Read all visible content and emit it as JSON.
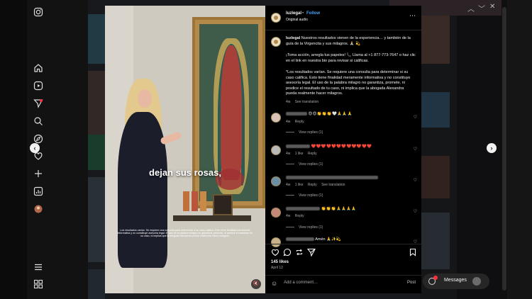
{
  "post": {
    "username": "luzlegal",
    "follow_label": "Follow",
    "audio": "Original audio",
    "caption_p1": "Nuestros resultados vienen de la experiencia… y también de la guía de la Virgencita y sus milagros. 🙏🏼 💫",
    "caption_p2": "¡Toma acción, arregla tus papeles! 📞 Llama al +1 877-773-7647 o haz clic en el link en nuestra bio para revisar si calificas.",
    "caption_p3": "*Los resultados varían. Se requiere una consulta para determinar si su caso califica. Esto tiene finalidad meramente informativa y no constituye asesoría legal. El uso de la palabra milagro no garantiza, promete, ni predice el resultado de tu caso, ni implica que la abogada Alexandra pueda realmente hacer milagros.",
    "caption_time": "4w",
    "see_translation": "See translation",
    "video_caption": "dejan sus rosas,",
    "video_disclaimer": "Los resultados varían. Se requiere una consulta para determinar si su caso califica. Esto tiene finalidad meramente informativa y no constituye asesoría legal. El uso de la palabra milagro no garantiza, promete, ni predice el resultado de su caso, ni implica que la abogada Alexandra pueda realmente hacer milagros."
  },
  "comments": [
    {
      "text": "😍😍👏👏👏🤍🙏🙏🙏",
      "time": "4w",
      "likes": "",
      "reply": "Reply",
      "translate": "",
      "view_replies": "View replies (1)"
    },
    {
      "text": "❤️❤️❤️❤️❤️❤️❤️❤️❤️❤️❤️❤️",
      "time": "4w",
      "likes": "1 like",
      "reply": "Reply",
      "translate": "",
      "view_replies": "View replies (1)"
    },
    {
      "text": "",
      "time": "4w",
      "likes": "1 like",
      "reply": "Reply",
      "translate": "See translation",
      "view_replies": "View replies (1)"
    },
    {
      "text": "👏👏👏🙏🙏🙏🙏",
      "time": "4w",
      "likes": "",
      "reply": "Reply",
      "translate": "",
      "view_replies": "View replies (1)"
    },
    {
      "text": "Amén 🙏✨💫",
      "time": "",
      "likes": "",
      "reply": "",
      "translate": "",
      "view_replies": ""
    }
  ],
  "stats": {
    "likes": "145 likes",
    "date": "April 12"
  },
  "composer": {
    "placeholder": "Add a comment…",
    "post_label": "Post"
  },
  "messages": {
    "label": "Messages"
  },
  "icons": {
    "more": "more-icon",
    "like": "heart-icon",
    "comment": "comment-icon",
    "share": "send-icon",
    "save": "bookmark-icon",
    "prev": "chevron-left-icon",
    "next": "chevron-right-icon"
  },
  "colors": {
    "link_blue": "#4aa3f5",
    "badge_red": "#ff3040",
    "panel_bg": "#000000"
  }
}
